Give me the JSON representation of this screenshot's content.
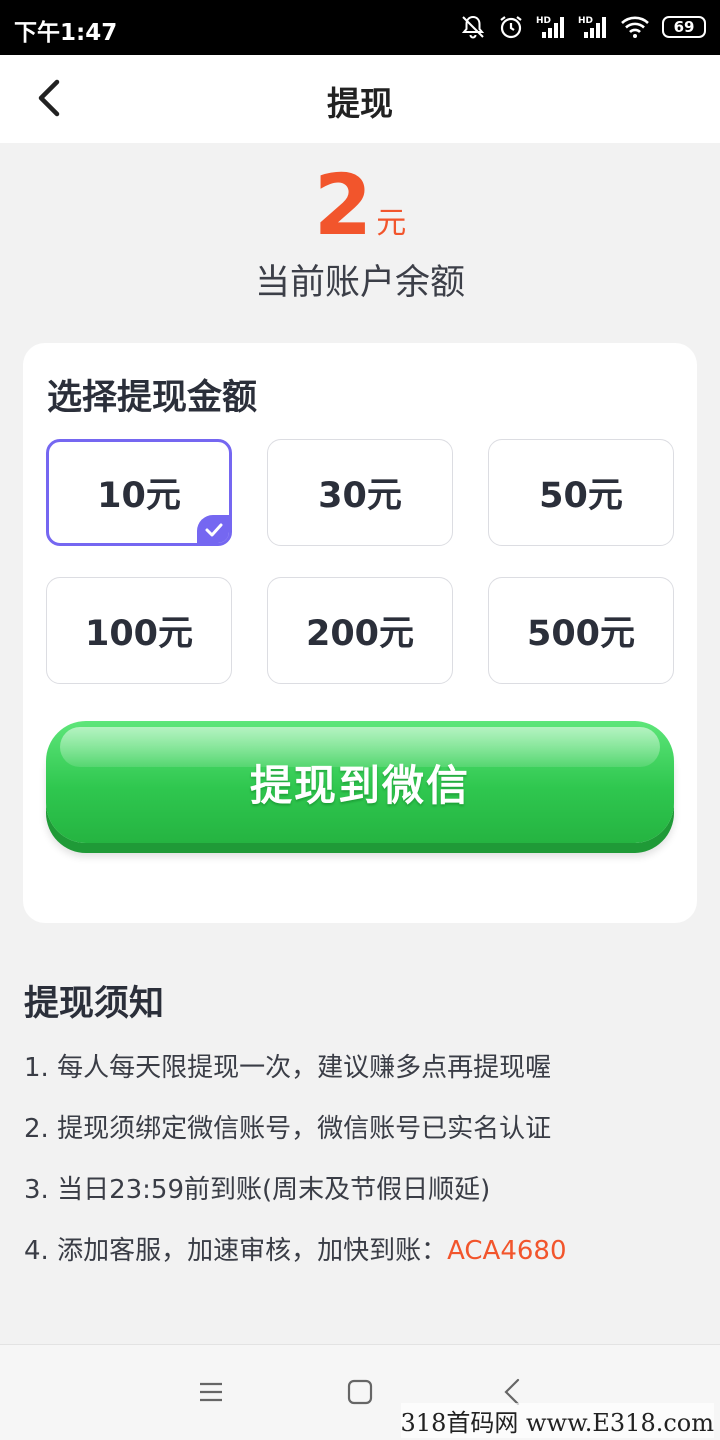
{
  "status_bar": {
    "time": "下午1:47",
    "battery": "69",
    "network_1": "HD",
    "network_2": "HD"
  },
  "header": {
    "title": "提现"
  },
  "balance": {
    "amount": "2",
    "unit": "元",
    "label": "当前账户余额"
  },
  "amount_card": {
    "title": "选择提现金额",
    "options": [
      {
        "label": "10元",
        "selected": true
      },
      {
        "label": "30元",
        "selected": false
      },
      {
        "label": "50元",
        "selected": false
      },
      {
        "label": "100元",
        "selected": false
      },
      {
        "label": "200元",
        "selected": false
      },
      {
        "label": "500元",
        "selected": false
      }
    ],
    "withdraw_button": "提现到微信"
  },
  "notice": {
    "title": "提现须知",
    "items": [
      "1. 每人每天限提现一次，建议赚多点再提现喔",
      "2. 提现须绑定微信账号，微信账号已实名认证",
      "3. 当日23:59前到账(周末及节假日顺延)",
      "4. 添加客服，加速审核，加快到账："
    ],
    "service_code": "ACA4680"
  },
  "watermark": "318首码网 www.E318.com",
  "colors": {
    "accent": "#f2552c",
    "selected": "#7567f1",
    "button_green": "#2fc74f"
  },
  "icons": [
    "bell-off-icon",
    "alarm-icon",
    "signal-icon",
    "wifi-icon",
    "battery-icon",
    "back-icon",
    "check-icon",
    "menu-icon",
    "home-icon",
    "nav-back-icon"
  ]
}
